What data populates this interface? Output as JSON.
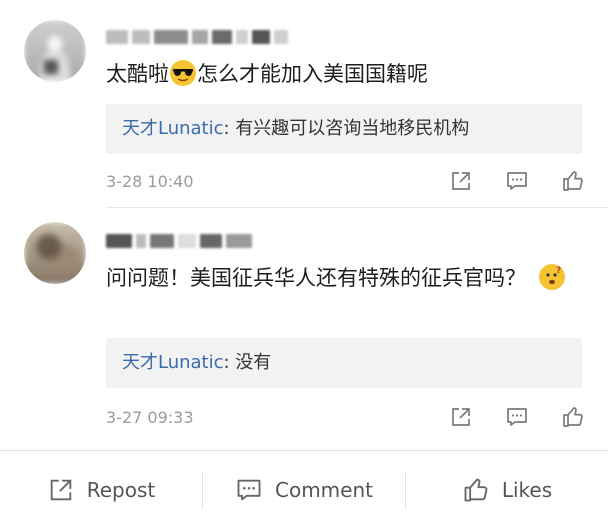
{
  "comments": [
    {
      "text_before": "太酷啦",
      "emoji1": "sunglasses-emoji",
      "text_after": "怎么才能加入美国国籍呢",
      "reply_user": "天才Lunatic",
      "reply_sep": ": ",
      "reply_text": "有兴趣可以咨询当地移民机构",
      "time": "3-28 10:40"
    },
    {
      "text_before": "问问题！美国征兵华人还有特殊的征兵官吗？",
      "emoji1": "thinking-emoji",
      "reply_user": "天才Lunatic",
      "reply_sep": ": ",
      "reply_text": "没有",
      "time": "3-27 09:33"
    }
  ],
  "footer": {
    "repost": "Repost",
    "comment": "Comment",
    "likes": "Likes"
  },
  "icons": {
    "share": "share-icon",
    "comment": "comment-icon",
    "like": "thumbs-up-icon"
  },
  "colors": {
    "reply_name": "#3b6cab",
    "reply_bg": "#f2f2f2",
    "icon": "#7a7a7a"
  }
}
